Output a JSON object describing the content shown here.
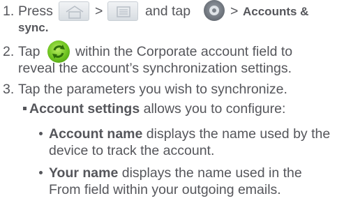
{
  "steps": [
    {
      "number": "1.",
      "press": "Press",
      "gt1": ">",
      "and_tap": "and tap",
      "gt2": ">",
      "target_bold": "Accounts &",
      "target_bold_2": "sync."
    },
    {
      "number": "2.",
      "tap": "Tap",
      "text_line1": "within the Corporate account field to",
      "text_line2": "reveal the account’s synchronization settings."
    },
    {
      "number": "3.",
      "text": "Tap the parameters you wish to synchronize."
    }
  ],
  "sub": {
    "bold": "Account settings",
    "rest": " allows you to configure:"
  },
  "items": [
    {
      "bold": "Account name",
      "line1_rest": " displays the name used by the",
      "line2": "device to track the account."
    },
    {
      "bold": "Your name",
      "line1_rest": " displays the name used in the",
      "line2": "From field within your outgoing emails."
    }
  ],
  "icons": [
    "home-key-icon",
    "menu-key-icon",
    "settings-gear-icon",
    "sync-icon"
  ],
  "colors": {
    "text": "#55565b",
    "sync_green": "#6cc21f",
    "key_bg": "#e1e5e9"
  }
}
